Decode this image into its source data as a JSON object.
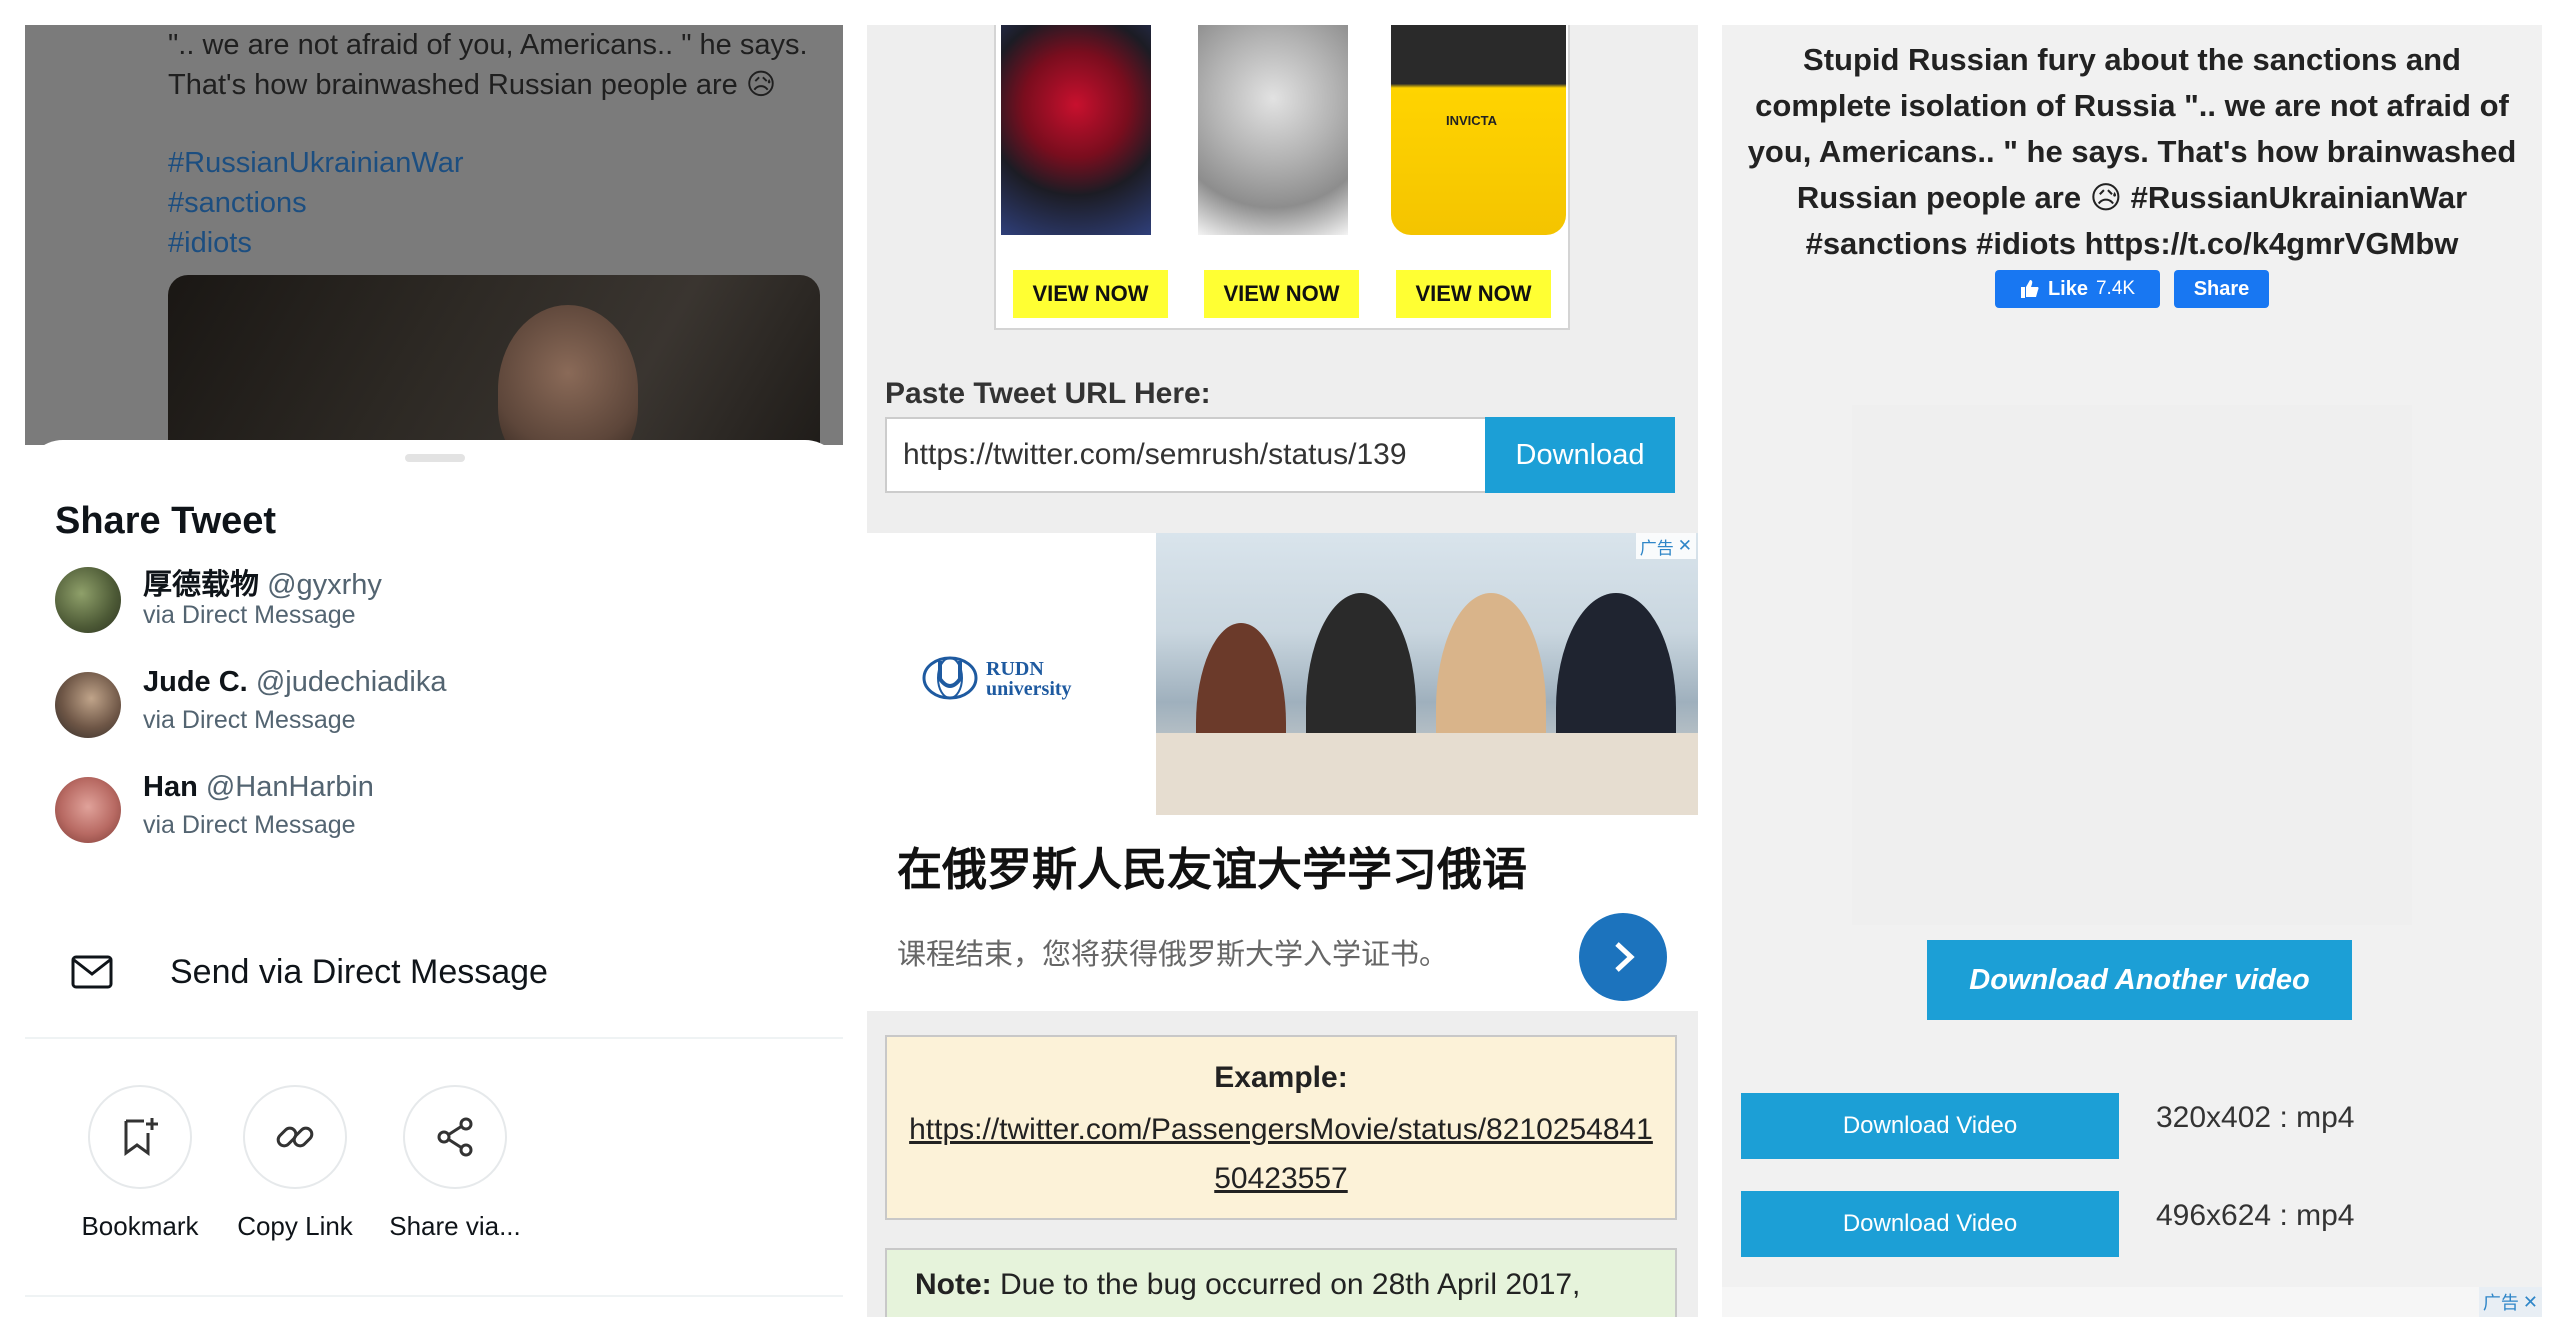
{
  "twitter": {
    "tweet_lines": [
      "\".. we are not afraid of you, Americans.. \" he says.",
      "That's how brainwashed Russian people are 😥"
    ],
    "hashtags": [
      "#RussianUkrainianWar",
      "#sanctions",
      "#idiots"
    ],
    "sheet_title": "Share Tweet",
    "dm_contacts": [
      {
        "name": "厚德载物",
        "handle": "@gyxrhy",
        "sub": "via Direct Message"
      },
      {
        "name": "Jude C.",
        "handle": "@judechiadika",
        "sub": "via Direct Message"
      },
      {
        "name": "Han",
        "handle": "@HanHarbin",
        "sub": "via Direct Message"
      }
    ],
    "send_dm_label": "Send via Direct Message",
    "actions": [
      {
        "label": "Bookmark",
        "icon": "bookmark-add-icon"
      },
      {
        "label": "Copy Link",
        "icon": "link-icon"
      },
      {
        "label": "Share via...",
        "icon": "share-icon"
      }
    ]
  },
  "downloader": {
    "watch_ad": {
      "buttons": [
        "VIEW NOW",
        "VIEW NOW",
        "VIEW NOW"
      ],
      "brand": "INVICTA"
    },
    "paste_label": "Paste Tweet URL Here:",
    "url_value": "https://twitter.com/semrush/status/139",
    "download_label": "Download",
    "rudn_ad": {
      "logo_line1": "RUDN",
      "logo_line2": "university",
      "badge": "广告",
      "headline": "在俄罗斯人民友谊大学学习俄语",
      "description": "课程结束，您将获得俄罗斯大学入学证书。"
    },
    "example": {
      "title": "Example:",
      "link": "https://twitter.com/PassengersMovie/status/821025484150423557"
    },
    "note": {
      "label": "Note:",
      "text": " Due to the bug occurred on 28th April 2017,"
    }
  },
  "result": {
    "tweet_text": "Stupid Russian fury about the sanctions and complete isolation of Russia \".. we are not afraid of you, Americans.. \" he says. That's how brainwashed Russian people are 😥 #RussianUkrainianWar #sanctions #idiots https://t.co/k4gmrVGMbw",
    "fb_like": "Like",
    "fb_like_count": "7.4K",
    "fb_share": "Share",
    "download_another": "Download Another video",
    "videos": [
      {
        "button": "Download Video",
        "resolution": "320x402 : mp4"
      },
      {
        "button": "Download Video",
        "resolution": "496x624 : mp4"
      }
    ],
    "corner_badge": "广告"
  },
  "colors": {
    "twitter_blue_link": "#1c4e80",
    "download_blue": "#1c9fd6",
    "facebook_blue": "#1877f2",
    "view_now_yellow": "#ffff33",
    "example_bg": "#fcf2d8",
    "note_bg": "#e6f3db"
  }
}
